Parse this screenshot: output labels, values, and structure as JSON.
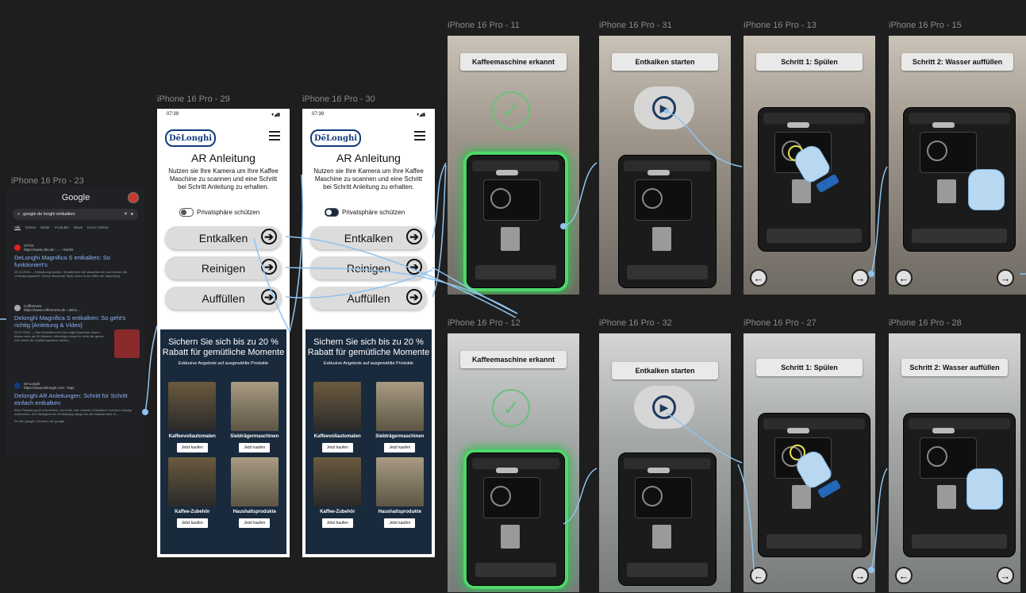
{
  "frames": {
    "google": {
      "label": "iPhone 16 Pro - 23",
      "logo": "Google",
      "search_value": "google de longhi entkalken",
      "tabs": [
        "Alle",
        "Videos",
        "Bilder",
        "Produkte",
        "News",
        "Kurze Videos"
      ],
      "results": [
        {
          "source": "OTTO",
          "url": "https://www.otto.de › ... › Küche",
          "title": "DeLonghi Magnifica S entkalken: So funktioniert's",
          "snippet": "25.10.2024 — Entkalkung starten: Schalte jetzt die Maschine ein und drücke die „Entkalkungstaste\" (Keine blinkende Taste unten in der Mitte der Maschine)."
        },
        {
          "source": "Coffeeness",
          "url": "https://www.coffeeness.de › delon...",
          "title": "Delonghi Magnifica S entkalken: So geht's richtig [Anleitung & Video]",
          "snippet": "03.07.2024 — Das Entkalken der DeLonghi Maschine dauert etwas mehr als 30 Minuten. Allerdings müsst ihr nicht die ganze Zeit neben der Kaffeemaschine stehen."
        },
        {
          "source": "De'Longhi",
          "url": "https://www.delonghi.com › faqs",
          "title": "Delonghi AR Anleitungen: Schritt für Schritt einfach entkalken",
          "snippet": "Eine Entkalkung ist erforderlich, wenn die rote Leuchte „Entkalken\" auf dem Display aufleuchtet. Die Häufigkeit der Entkalkung hängt von der Wasserhärte in ..."
        }
      ],
      "footer": "Es tritt: google | Suchen mit: google"
    },
    "web29": {
      "label": "iPhone 16 Pro - 29"
    },
    "web30": {
      "label": "iPhone 16 Pro - 30"
    },
    "ar": [
      {
        "label": "iPhone 16 Pro - 11",
        "title": "Kaffeemaschine erkannt"
      },
      {
        "label": "iPhone 16 Pro - 31",
        "title": "Entkalken starten"
      },
      {
        "label": "iPhone 16 Pro - 13",
        "title": "Schritt 1: Spülen"
      },
      {
        "label": "iPhone 16 Pro - 15",
        "title": "Schritt 2: Wasser auffüllen"
      },
      {
        "label": "iPhone 16 Pro - 12",
        "title": "Kaffeemaschine erkannt"
      },
      {
        "label": "iPhone 16 Pro - 32",
        "title": "Entkalken starten"
      },
      {
        "label": "iPhone 16 Pro - 27",
        "title": "Schritt 1: Spülen"
      },
      {
        "label": "iPhone 16 Pro - 28",
        "title": "Schritt 2: Wasser auffüllen"
      }
    ]
  },
  "web": {
    "time": "07:39",
    "status_icons": "▾◢▮",
    "logo": "DēLonghi",
    "title": "AR Anleitung",
    "description": "Nutzen sie Ihre Kamera um Ihre Kaffee Maschine zu scannen und eine Schritt bei Schritt Anleitung zu erhalten.",
    "privacy": "Privatsphäre schützen",
    "buttons": [
      "Entkalken",
      "Reinigen",
      "Auffüllen"
    ],
    "arrow": "➔",
    "promo_title": "Sichern Sie sich bis zu 20 % Rabatt für gemütliche Momente",
    "promo_sub": "Exklusive Angebote auf ausgewählte Produkte",
    "categories": [
      "Kaffeevollautomaten",
      "Siebträgermaschinen",
      "Kaffee-Zubehör",
      "Haushaltsprodukte"
    ],
    "buy": "Jetzt kaufen"
  },
  "ar_ui": {
    "back": "←",
    "next": "→",
    "check": "✓",
    "play": "▶"
  },
  "colors": {
    "canvas": "#1e1e1e",
    "link": "#8fc3f0",
    "glow": "#4fd86a",
    "brand": "#123c7c",
    "promo": "#1a2a3d"
  }
}
